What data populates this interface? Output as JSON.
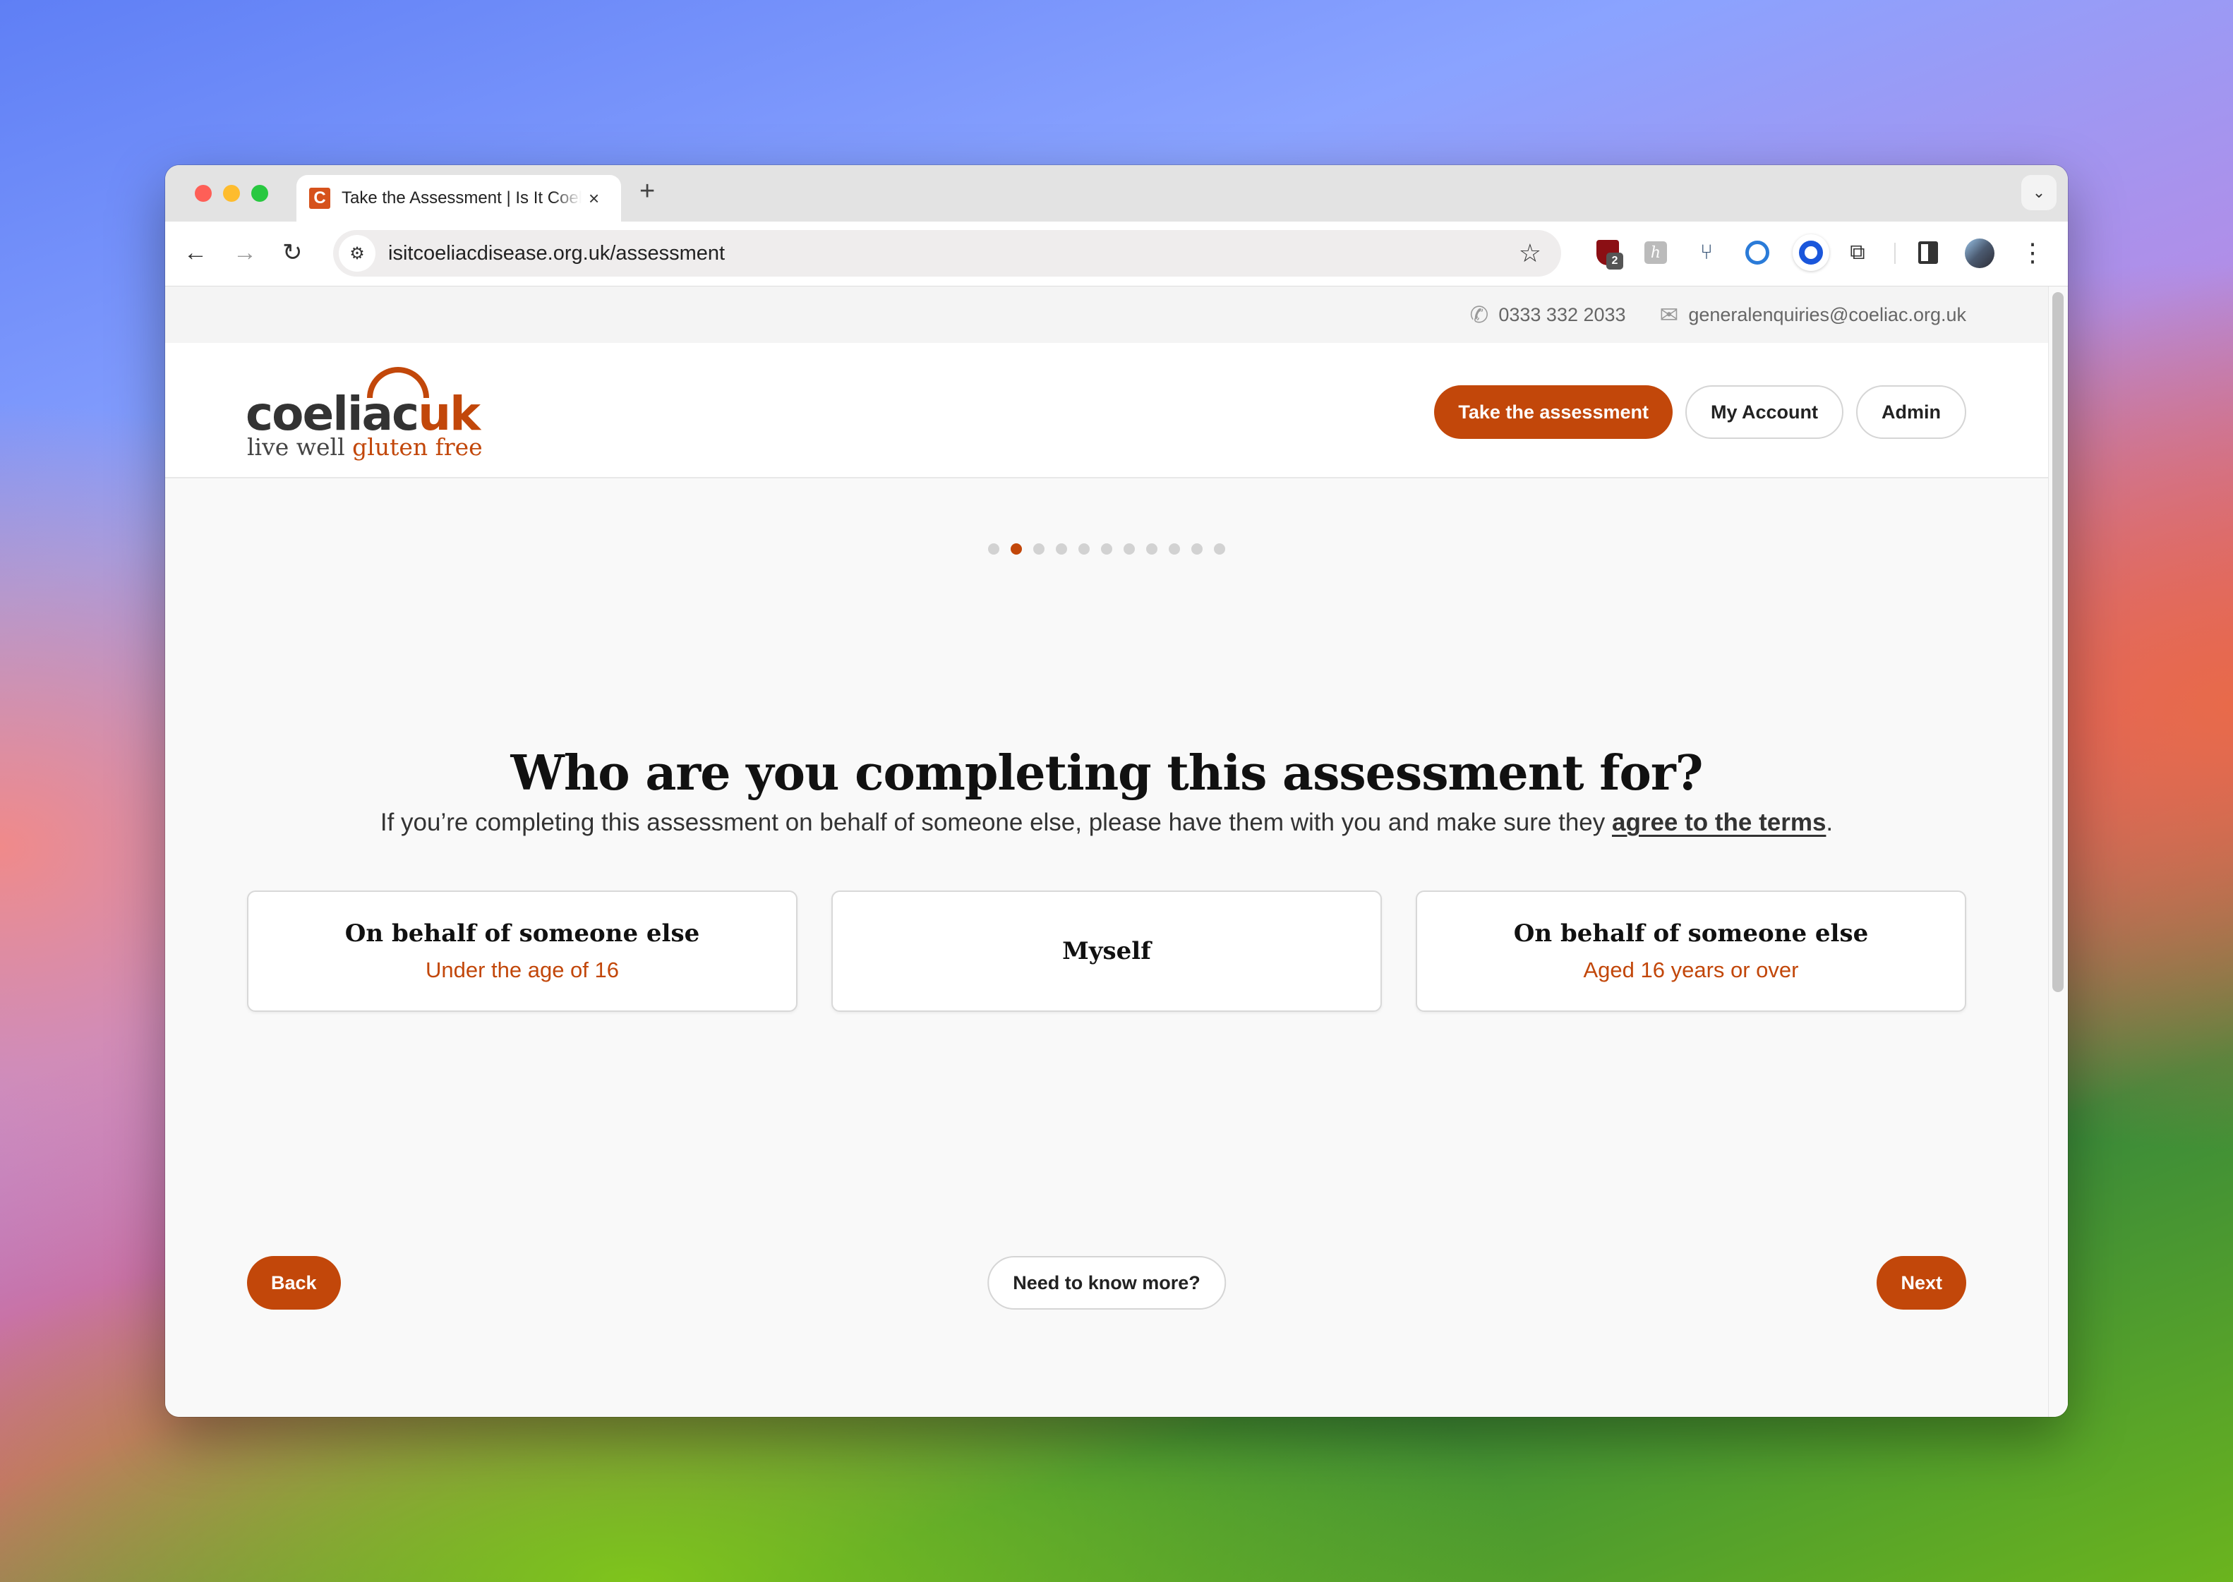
{
  "browser": {
    "tab": {
      "favicon": "C",
      "title": "Take the Assessment | Is It Coeliac Disease?",
      "close": "×"
    },
    "new_tab": "+",
    "tab_search": "⌄",
    "nav": {
      "back": "←",
      "forward": "→",
      "reload": "↻"
    },
    "site_info_icon": "⚙",
    "url": "isitcoeliacdisease.org.uk/assessment",
    "bookmark_icon": "☆",
    "extensions": [
      {
        "name": "ublock-origin",
        "badge": "2"
      },
      {
        "name": "honey",
        "glyph": "h"
      },
      {
        "name": "fork-extension",
        "glyph": "⑂"
      },
      {
        "name": "1password"
      },
      {
        "name": "circle-extension"
      },
      {
        "name": "extensions-puzzle",
        "glyph": "⧉"
      }
    ],
    "menu": "⋮"
  },
  "topbar": {
    "phone_icon": "✆",
    "phone": "0333 332 2033",
    "email_icon": "✉",
    "email": "generalenquiries@coeliac.org.uk"
  },
  "header": {
    "logo": {
      "word": "coeliac",
      "uk": "uk",
      "tagline_start": "live well ",
      "tagline_accent": "gluten free"
    },
    "nav": {
      "take_assessment": "Take the assessment",
      "my_account": "My Account",
      "admin": "Admin"
    }
  },
  "progress": {
    "total_steps": 11,
    "current_step": 2
  },
  "question": {
    "title": "Who are you completing this assessment for?",
    "subtitle_before": "If you’re completing this assessment on behalf of someone else, please have them with you and make sure they ",
    "subtitle_link": "agree to the terms",
    "subtitle_after": "."
  },
  "options": [
    {
      "title": "On behalf of someone else",
      "subtitle": "Under the age of 16"
    },
    {
      "title": "Myself",
      "subtitle": ""
    },
    {
      "title": "On behalf of someone else",
      "subtitle": "Aged 16 years or over"
    }
  ],
  "footer": {
    "back": "Back",
    "more": "Need to know more?",
    "next": "Next"
  },
  "colors": {
    "brand": "#c2470a",
    "inactive_dot": "#d2d2d2"
  }
}
